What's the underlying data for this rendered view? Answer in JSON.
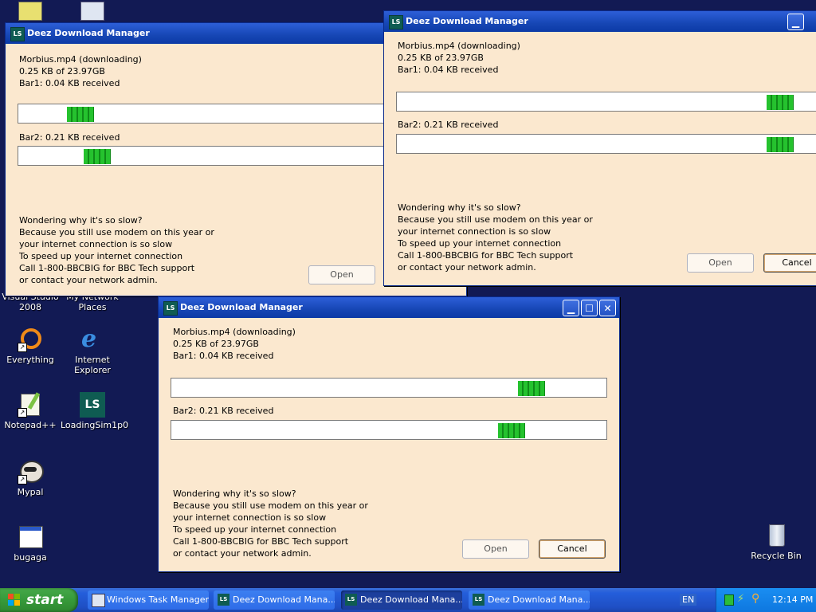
{
  "desktop": {
    "icons": [
      {
        "label": "Microsoft Visual Studio 2008",
        "name": "visual-studio-icon"
      },
      {
        "label": "My Network Places",
        "name": "network-places-icon"
      },
      {
        "label": "Everything",
        "name": "everything-icon"
      },
      {
        "label": "Internet Explorer",
        "name": "internet-explorer-icon"
      },
      {
        "label": "Notepad++",
        "name": "notepad-plus-plus-icon"
      },
      {
        "label": "LoadingSim1p0",
        "name": "loadingsim-icon"
      },
      {
        "label": "Mypal",
        "name": "mypal-icon"
      },
      {
        "label": "bugaga",
        "name": "bugaga-icon"
      },
      {
        "label": "Recycle Bin",
        "name": "recycle-bin-icon"
      }
    ]
  },
  "window": {
    "title": "Deez Download Manager",
    "app_icon": "LS",
    "file_line": "Morbius.mp4 (downloading)",
    "size_line": "0.25 KB of 23.97GB",
    "bar1_label": "Bar1: 0.04 KB received",
    "bar2_label": "Bar2: 0.21 KB received",
    "message": [
      "Wondering why it's so slow?",
      "Because you still use modem on this year or",
      "your internet connection is so slow",
      "To speed up your internet connection",
      "Call 1-800-BBCBIG for BBC Tech support",
      "or contact your network admin."
    ],
    "open_label": "Open",
    "cancel_label": "Cancel"
  },
  "windows": [
    {
      "id": "left",
      "bar1_position": 0.12,
      "bar2_position": 0.16
    },
    {
      "id": "right",
      "bar1_position": 0.92,
      "bar2_position": 0.92
    },
    {
      "id": "front",
      "bar1_position": 0.85,
      "bar2_position": 0.8
    }
  ],
  "taskbar": {
    "start_label": "start",
    "tasks": [
      {
        "label": "Windows Task Manager",
        "active": false
      },
      {
        "label": "Deez Download Mana...",
        "active": false
      },
      {
        "label": "Deez Download Mana...",
        "active": true
      },
      {
        "label": "Deez Download Mana...",
        "active": false
      }
    ],
    "language": "EN",
    "clock": "12:14 PM"
  },
  "colors": {
    "desktop": "#121a54",
    "window_bg": "#fbe8cf",
    "progress_green": "#25c22e",
    "titlebar": "#1646b4"
  }
}
